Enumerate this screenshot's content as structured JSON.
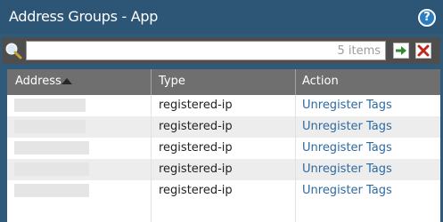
{
  "window": {
    "title": "Address Groups - App",
    "help_icon": "help-icon"
  },
  "toolbar": {
    "search_value": "",
    "item_count": "5 items",
    "icons": {
      "search": "search-icon",
      "apply": "apply-filter-icon",
      "clear": "clear-filter-icon"
    },
    "colors": {
      "apply": "#2e8a2e",
      "clear": "#c0281f"
    }
  },
  "table": {
    "columns": [
      "Address",
      "Type",
      "Action"
    ],
    "sort": {
      "column": "Address",
      "direction": "ascending"
    },
    "rows": [
      {
        "type": "registered-ip",
        "action": "Unregister Tags"
      },
      {
        "type": "registered-ip",
        "action": "Unregister Tags"
      },
      {
        "type": "registered-ip",
        "action": "Unregister Tags"
      },
      {
        "type": "registered-ip",
        "action": "Unregister Tags"
      },
      {
        "type": "registered-ip",
        "action": "Unregister Tags"
      }
    ]
  },
  "colors": {
    "titlebar": "#2d5575",
    "header": "#6f6f6f",
    "link": "#2d6aa1"
  }
}
